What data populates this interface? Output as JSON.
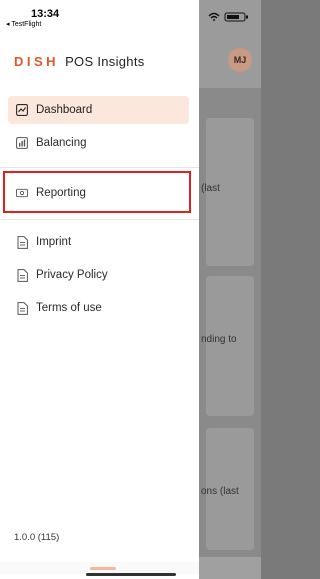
{
  "statusbar": {
    "time": "13:34",
    "back_app": "◂ TestFlight"
  },
  "brand": {
    "dish": "DISH",
    "rest": "POS Insights"
  },
  "nav": {
    "items": [
      {
        "label": "Dashboard",
        "icon": "chart-icon",
        "active": true
      },
      {
        "label": "Balancing",
        "icon": "bar-chart-icon",
        "active": false
      },
      {
        "label": "Reporting",
        "icon": "cash-icon",
        "active": false,
        "highlighted": true
      },
      {
        "label": "Imprint",
        "icon": "document-icon",
        "active": false
      },
      {
        "label": "Privacy Policy",
        "icon": "document-icon",
        "active": false
      },
      {
        "label": "Terms of use",
        "icon": "document-icon",
        "active": false
      }
    ]
  },
  "version": "1.0.0 (115)",
  "background": {
    "avatar": "MJ",
    "card_texts": [
      "(last",
      "nding to",
      "ons (last"
    ]
  },
  "colors": {
    "brand_orange": "#e2572b",
    "active_bg": "#fbe7dc",
    "highlight": "#e0211d"
  }
}
